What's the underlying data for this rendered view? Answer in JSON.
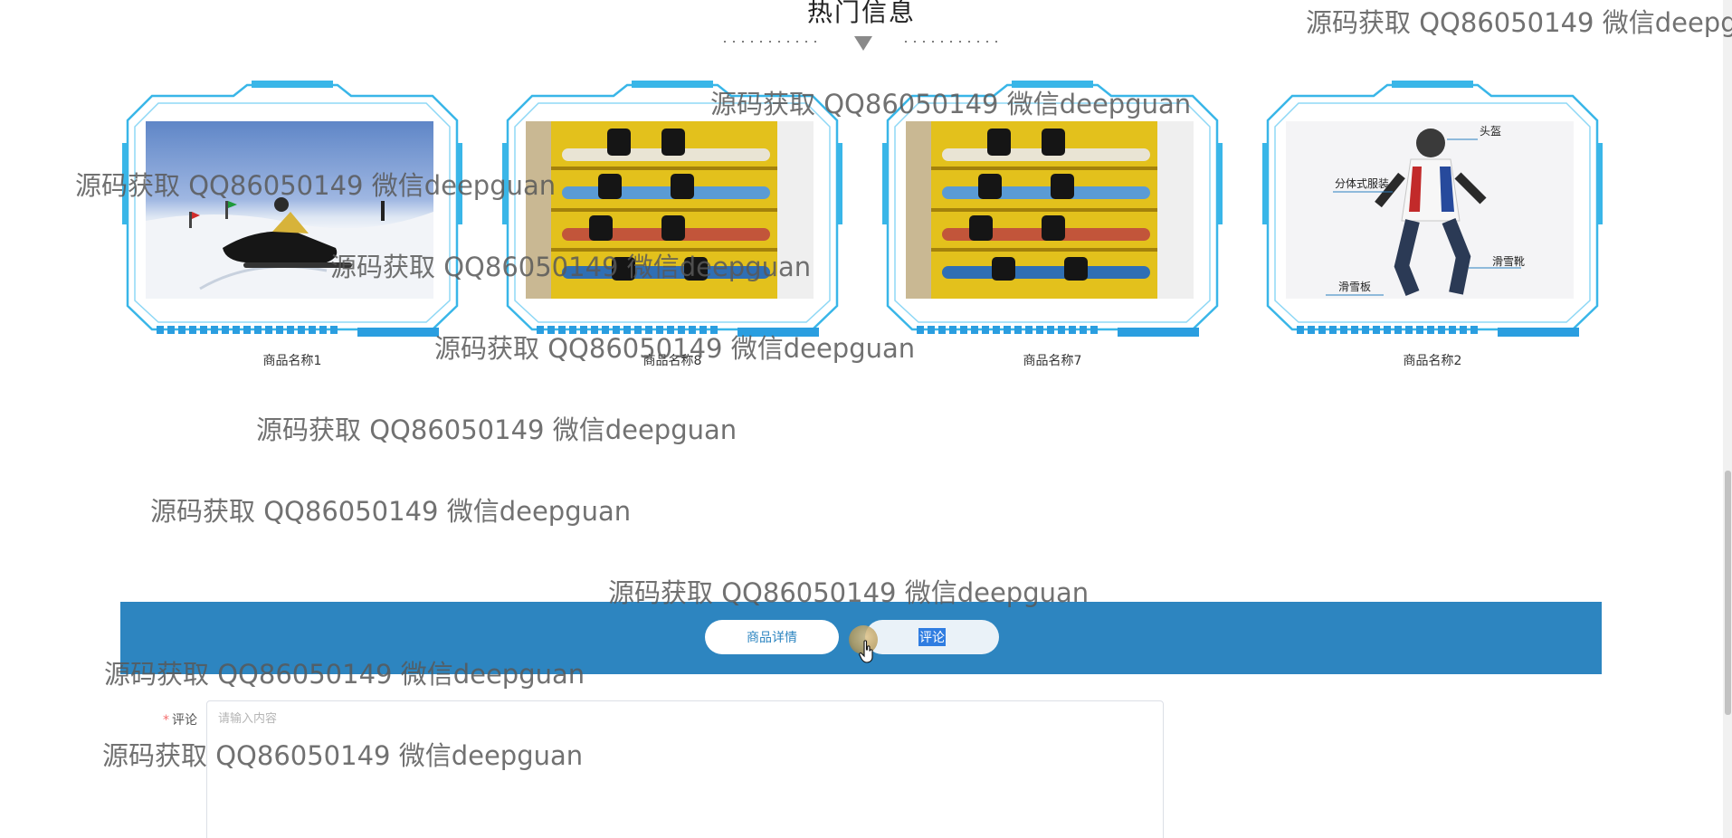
{
  "section": {
    "title": "热门信息"
  },
  "products": [
    {
      "name": "商品名称1",
      "image": "snowmobile-photo"
    },
    {
      "name": "商品名称8",
      "image": "snowboard-shop-photo"
    },
    {
      "name": "商品名称7",
      "image": "snowboard-shop-photo"
    },
    {
      "name": "商品名称2",
      "image": "snowboard-gear-diagram",
      "labels": {
        "helmet": "头盔",
        "suit": "分体式服装",
        "boots": "滑雪靴",
        "board": "滑雪板"
      }
    }
  ],
  "tabs": {
    "details": "商品详情",
    "comment": "评论"
  },
  "form": {
    "required_mark": "*",
    "comment_label": "评论",
    "comment_placeholder": "请输入内容"
  },
  "watermarks": [
    "源码获取 QQ86050149 微信deepg",
    "源码获取 QQ86050149 微信deepguan",
    "源码获取 QQ86050149 微信deepguan",
    "源码获取 QQ86050149 微信deepguan",
    "源码获取 QQ86050149 微信deepguan",
    "源码获取 QQ86050149 微信deepguan",
    "源码获取 QQ86050149 微信deepguan",
    "源码获取 QQ86050149 微信deepguan",
    "源码获取 QQ86050149 微信deepguan",
    "源码获取 QQ86050149 微信deepguan"
  ],
  "colors": {
    "accent": "#2d85c0",
    "frame": "#39b6e8",
    "required": "#f56c6c"
  }
}
